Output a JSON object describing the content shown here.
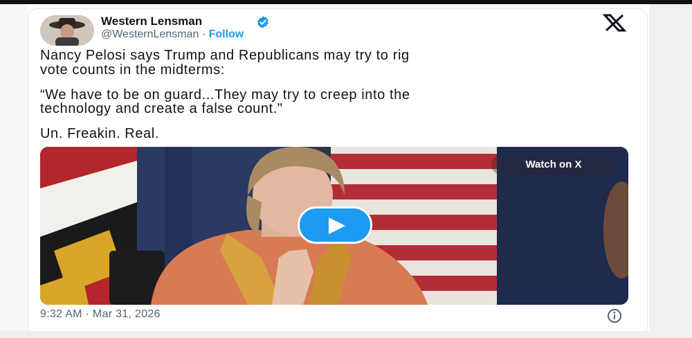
{
  "tweet": {
    "author_name": "Western Lensman",
    "handle": "@WesternLensman",
    "separator": "·",
    "follow_label": "Follow",
    "text_lines": [
      "Nancy Pelosi says Trump and Republicans may try to rig",
      "vote counts in the midterms:",
      "“We have to be on guard...They may try to creep into the",
      "technology and create a false count.\"",
      "Un. Freakin. Real."
    ],
    "media": {
      "watch_label": "Watch on X",
      "play_icon": "play-icon"
    },
    "timestamp": "9:32 AM · Mar 31, 2026"
  },
  "icons": {
    "verified": "verified-badge-icon",
    "logo": "x-logo-icon",
    "info": "info-icon"
  },
  "colors": {
    "accent": "#1d9bf0",
    "text": "#0f1419",
    "muted": "#536471"
  }
}
